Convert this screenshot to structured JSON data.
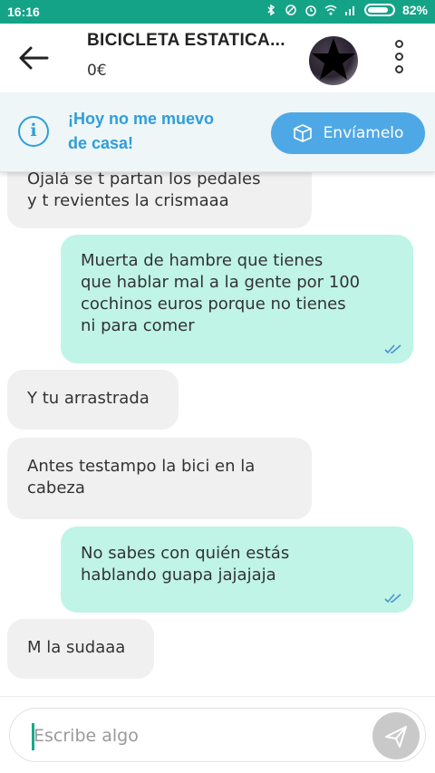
{
  "status_bar": {
    "time": "16:16",
    "battery": "82%"
  },
  "header": {
    "title": "BICICLETA ESTATICA...",
    "price": "0€"
  },
  "banner": {
    "text_line1": "¡Hoy no me muevo",
    "text_line2": "de casa!",
    "button_label": "Envíamelo"
  },
  "messages": [
    {
      "direction": "in",
      "lines": [
        "Ojalá se t partan los pedales",
        "y t revientes la crismaaa"
      ]
    },
    {
      "direction": "out",
      "lines": [
        "Muerta de hambre que tienes",
        "que hablar mal a la gente por 100",
        "cochinos euros porque no tienes",
        "ni para comer"
      ],
      "read": true
    },
    {
      "direction": "in",
      "lines": [
        "Y tu arrastrada"
      ]
    },
    {
      "direction": "in",
      "lines": [
        "Antes testampo la bici en la",
        "cabeza"
      ]
    },
    {
      "direction": "out",
      "lines": [
        "No sabes con quién estás",
        "hablando guapa jajajaja"
      ],
      "read": true
    },
    {
      "direction": "in",
      "lines": [
        "M la sudaaa"
      ]
    }
  ],
  "input": {
    "placeholder": "Escribe algo"
  },
  "colors": {
    "status_bar": "#15a388",
    "accent_blue": "#4fa8e6",
    "outgoing_bubble": "#bff4e6",
    "incoming_bubble": "#f0f0f0"
  },
  "icons": {
    "back": "arrow-left-icon",
    "menu": "more-vertical-icon",
    "info": "info-icon",
    "shipping": "box-icon",
    "send": "send-icon",
    "read_receipt": "double-check-icon"
  }
}
